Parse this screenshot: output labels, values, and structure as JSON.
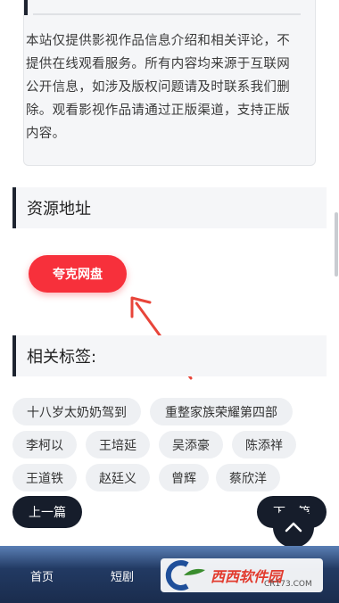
{
  "notice": {
    "text": "本站仅提供影视作品信息介绍和相关评论，不提供在线观看服务。所有内容均来源于互联网公开信息，如涉及版权问题请及时联系我们删除。观看影视作品请通过正版渠道，支持正版内容。"
  },
  "resources": {
    "title": "资源地址",
    "button_label": "夸克网盘"
  },
  "tags_section": {
    "title": "相关标签:",
    "tags": [
      "十八岁太奶奶驾到",
      "重整家族荣耀第四部",
      "李柯以",
      "王培延",
      "吴添豪",
      "陈添祥",
      "王道铁",
      "赵廷义",
      "曾辉",
      "蔡欣洋"
    ]
  },
  "pager": {
    "prev_label": "上一篇",
    "next_label": "下一篇"
  },
  "bottom_nav": {
    "items": [
      "首页",
      "短剧"
    ]
  },
  "watermark": {
    "brand": "西西软件园",
    "site": "CR173.COM"
  },
  "colors": {
    "accent_red": "#f7303b",
    "dark_navy": "#161d2b"
  }
}
